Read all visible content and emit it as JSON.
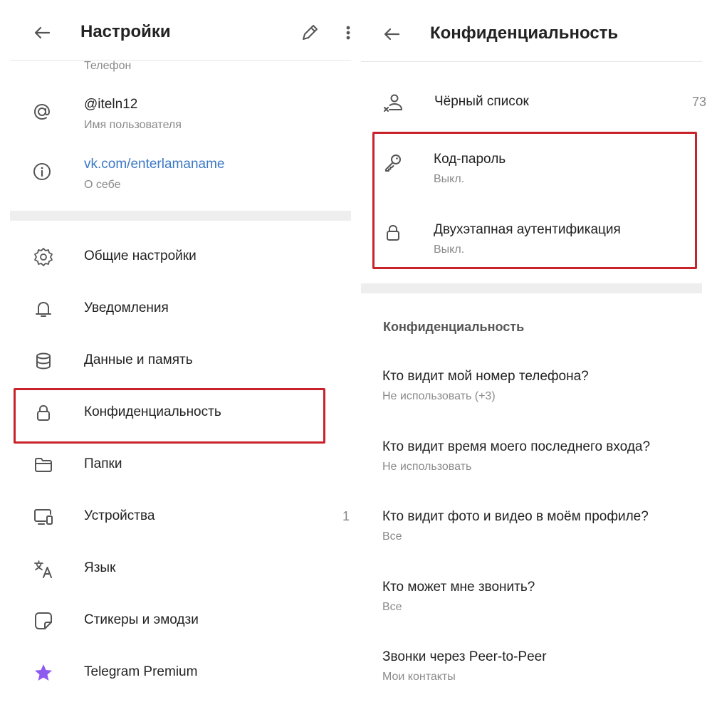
{
  "colors": {
    "highlight": "#c8232a",
    "link": "#3a78c6",
    "premium": "#8e5bf0",
    "secondary_text": "#8a8a8a"
  },
  "left": {
    "title": "Настройки",
    "phone_sub": "Телефон",
    "username": {
      "value": "@iteln12",
      "sub": "Имя пользователя",
      "icon": "at-icon"
    },
    "bio": {
      "value": "vk.com/enterlamaname",
      "sub": "О себе",
      "icon": "info-icon"
    },
    "items": [
      {
        "label": "Общие настройки",
        "icon": "gear-icon"
      },
      {
        "label": "Уведомления",
        "icon": "bell-icon"
      },
      {
        "label": "Данные и память",
        "icon": "database-icon"
      },
      {
        "label": "Конфиденциальность",
        "icon": "lock-icon",
        "highlighted": true
      },
      {
        "label": "Папки",
        "icon": "folder-icon"
      },
      {
        "label": "Устройства",
        "icon": "devices-icon",
        "count": "1"
      },
      {
        "label": "Язык",
        "icon": "translate-icon"
      },
      {
        "label": "Стикеры и эмодзи",
        "icon": "sticker-icon"
      },
      {
        "label": "Telegram Premium",
        "icon": "star-icon"
      }
    ]
  },
  "right": {
    "title": "Конфиденциальность",
    "blacklist": {
      "label": "Чёрный список",
      "count": "73",
      "icon": "blocked-user-icon"
    },
    "passcode": {
      "label": "Код-пароль",
      "sub": "Выкл.",
      "icon": "key-icon"
    },
    "two_step": {
      "label": "Двухэтапная аутентификация",
      "sub": "Выкл.",
      "icon": "lock-icon"
    },
    "section_header": "Конфиденциальность",
    "privacy_items": [
      {
        "label": "Кто видит мой номер телефона?",
        "sub": "Не использовать (+3)"
      },
      {
        "label": "Кто видит время моего последнего входа?",
        "sub": "Не использовать"
      },
      {
        "label": "Кто видит фото и видео в моём профиле?",
        "sub": "Все"
      },
      {
        "label": "Кто может мне звонить?",
        "sub": "Все"
      },
      {
        "label": "Звонки через Peer-to-Peer",
        "sub": "Мои контакты"
      }
    ]
  }
}
